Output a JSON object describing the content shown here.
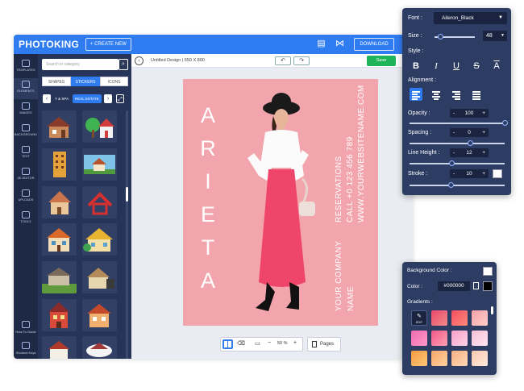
{
  "app": {
    "logo": "PHOTOKING",
    "create_label": "+ CREATE NEW",
    "download_label": "DOWNLOAD"
  },
  "rail": {
    "items": [
      {
        "label": "TEMPLATES"
      },
      {
        "label": "ELEMENTS"
      },
      {
        "label": "IMAGES"
      },
      {
        "label": "BACKGROUND"
      },
      {
        "label": "TEXT"
      },
      {
        "label": "3D EDITOR"
      },
      {
        "label": "UPLOADS"
      },
      {
        "label": "TOOLS"
      }
    ],
    "bottom": [
      {
        "label": "How-To Guide"
      },
      {
        "label": "Shortcut Keys"
      }
    ]
  },
  "panel": {
    "search_placeholder": "Search in category",
    "tabs": [
      "SHAPES",
      "STICKERS",
      "ICONS"
    ],
    "categories": [
      "Y & SPA",
      "REAL ESTATE"
    ]
  },
  "canvas": {
    "title": "Untitled Design | 650 X 800",
    "save_label": "Save",
    "zoom_label": "50 %",
    "pages_label": "Pages"
  },
  "poster": {
    "letters": [
      "A",
      "R",
      "I",
      "E",
      "T",
      "A"
    ],
    "line1": "RESERVATIONS",
    "line2": "CALL +0 123 456 789",
    "line3": "WWW.YOURWEBSITENAME.COM",
    "company1": "YOUR COMPANY",
    "company2": "NAME"
  },
  "text_panel": {
    "font_label": "Font :",
    "font_value": "Aileron_Black",
    "size_label": "Size :",
    "size_value": "48",
    "style_label": "Style :",
    "style_buttons": [
      "B",
      "I",
      "U",
      "S",
      "A"
    ],
    "alignment_label": "Alignment :",
    "opacity_label": "Opacity :",
    "opacity_value": "100",
    "spacing_label": "Spacing :",
    "spacing_value": "0",
    "line_height_label": "Line Height :",
    "line_height_value": "12",
    "stroke_label": "Stroke :",
    "stroke_value": "10"
  },
  "bg_panel": {
    "bg_color_label": "Background Color :",
    "color_label": "Color :",
    "color_value": "#000000",
    "gradients_label": "Gradients :",
    "edit_label": "EDIT"
  },
  "colors": {
    "accent": "#2f7bf0",
    "poster_bg": "#f3a5ad",
    "panel_dark": "#2c3c63",
    "save_green": "#1fb35a"
  }
}
